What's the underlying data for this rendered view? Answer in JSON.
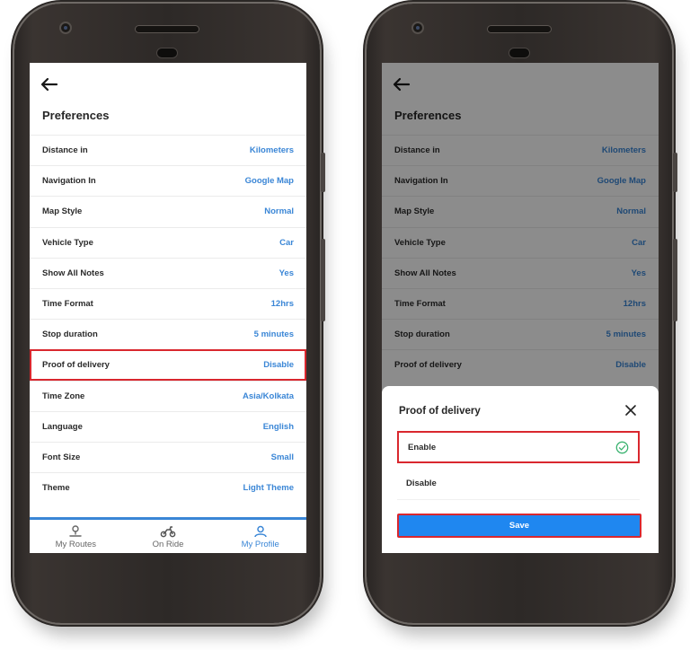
{
  "left_screen": {
    "title": "Preferences",
    "rows": [
      {
        "label": "Distance in",
        "value": "Kilometers"
      },
      {
        "label": "Navigation In",
        "value": "Google Map"
      },
      {
        "label": "Map Style",
        "value": "Normal"
      },
      {
        "label": "Vehicle Type",
        "value": "Car"
      },
      {
        "label": "Show All Notes",
        "value": "Yes"
      },
      {
        "label": "Time Format",
        "value": "12hrs"
      },
      {
        "label": "Stop duration",
        "value": "5 minutes"
      },
      {
        "label": "Proof of delivery",
        "value": "Disable"
      },
      {
        "label": "Time Zone",
        "value": "Asia/Kolkata"
      },
      {
        "label": "Language",
        "value": "English"
      },
      {
        "label": "Font Size",
        "value": "Small"
      },
      {
        "label": "Theme",
        "value": "Light Theme"
      }
    ],
    "nav": [
      {
        "label": "My Routes",
        "icon": "route-pin-icon"
      },
      {
        "label": "On Ride",
        "icon": "scooter-icon"
      },
      {
        "label": "My Profile",
        "icon": "profile-icon"
      }
    ],
    "active_nav": "My Profile"
  },
  "right_screen": {
    "title": "Preferences",
    "rows": [
      {
        "label": "Distance in",
        "value": "Kilometers"
      },
      {
        "label": "Navigation In",
        "value": "Google Map"
      },
      {
        "label": "Map Style",
        "value": "Normal"
      },
      {
        "label": "Vehicle Type",
        "value": "Car"
      },
      {
        "label": "Show All Notes",
        "value": "Yes"
      },
      {
        "label": "Time Format",
        "value": "12hrs"
      },
      {
        "label": "Stop duration",
        "value": "5 minutes"
      },
      {
        "label": "Proof of delivery",
        "value": "Disable"
      }
    ],
    "sheet": {
      "title": "Proof of delivery",
      "options": [
        {
          "label": "Enable",
          "selected": true
        },
        {
          "label": "Disable",
          "selected": false
        }
      ],
      "save_label": "Save"
    }
  },
  "colors": {
    "accent": "#3a86d6",
    "save_button": "#1f87f0",
    "highlight_border": "#d9272e",
    "check": "#3cb371"
  }
}
